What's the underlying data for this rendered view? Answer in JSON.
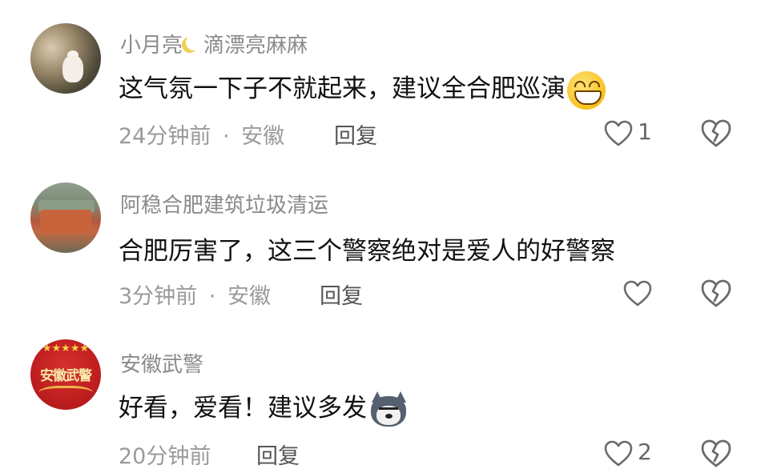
{
  "comments": [
    {
      "username": "小月亮",
      "username_suffix": "滴漂亮麻麻",
      "username_emoji": "crescent-moon-emoji",
      "text": "这气氛一下子不就起来，建议全合肥巡演",
      "text_emoji": "grinning-face-emoji",
      "time": "24分钟前",
      "separator": "·",
      "location": "安徽",
      "reply_label": "回复",
      "like_count": "1"
    },
    {
      "username": "阿稳合肥建筑垃圾清运",
      "text": "合肥厉害了，这三个警察绝对是爱人的好警察",
      "time": "3分钟前",
      "separator": "·",
      "location": "安徽",
      "reply_label": "回复",
      "like_count": ""
    },
    {
      "username": "安徽武警",
      "avatar_text": "安徽武警",
      "avatar_stars": "★★★★★",
      "text": "好看，爱看！建议多发",
      "text_emoji": "husky-dog-emoji",
      "time": "20分钟前",
      "reply_label": "回复",
      "like_count": "2"
    }
  ],
  "icons": {
    "like": "heart-outline-icon",
    "dislike": "broken-heart-icon"
  },
  "colors": {
    "username": "#8a8a8a",
    "text": "#111111",
    "meta": "#9a9a9a",
    "icon": "#6b6b6b"
  }
}
